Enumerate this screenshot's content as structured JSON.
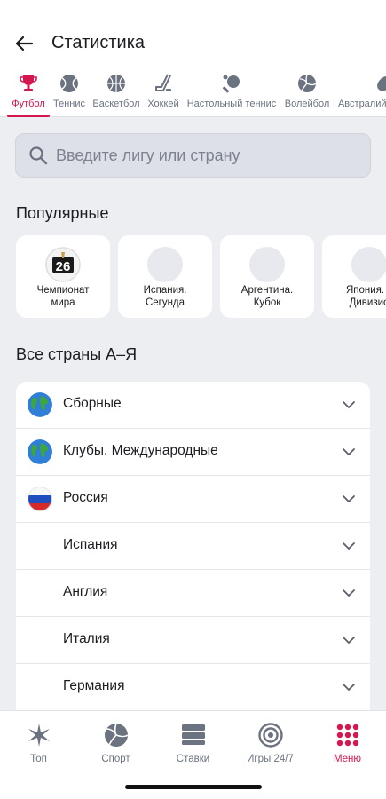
{
  "header": {
    "title": "Статистика",
    "back_icon": "arrow-left-icon"
  },
  "tabs": [
    {
      "label": "Футбол",
      "icon": "trophy-icon",
      "active": true
    },
    {
      "label": "Теннис",
      "icon": "tennis-ball-icon"
    },
    {
      "label": "Баскетбол",
      "icon": "basketball-icon"
    },
    {
      "label": "Хоккей",
      "icon": "hockey-stick-icon"
    },
    {
      "label": "Настольный теннис",
      "icon": "ping-pong-icon"
    },
    {
      "label": "Волейбол",
      "icon": "volleyball-icon"
    },
    {
      "label": "Австралийс",
      "icon": "aussie-rules-icon"
    }
  ],
  "search": {
    "placeholder": "Введите лигу или страну"
  },
  "popular": {
    "title": "Популярные",
    "items": [
      {
        "label": "Чемпионат\nмира",
        "logo": "world-cup-26-logo"
      },
      {
        "label": "Испания.\nСегунда",
        "logo": ""
      },
      {
        "label": "Аргентина.\nКубок",
        "logo": ""
      },
      {
        "label": "Япония. J\nДивизио",
        "logo": ""
      }
    ]
  },
  "countries": {
    "title": "Все страны А–Я",
    "items": [
      {
        "label": "Сборные",
        "flag": "globe"
      },
      {
        "label": "Клубы. Международные",
        "flag": "globe"
      },
      {
        "label": "Россия",
        "flag": "russia"
      },
      {
        "label": "Испания",
        "flag": ""
      },
      {
        "label": "Англия",
        "flag": ""
      },
      {
        "label": "Италия",
        "flag": ""
      },
      {
        "label": "Германия",
        "flag": ""
      }
    ]
  },
  "bottom_nav": [
    {
      "label": "Топ",
      "icon": "star-burst-icon"
    },
    {
      "label": "Спорт",
      "icon": "volleyball-icon"
    },
    {
      "label": "Ставки",
      "icon": "bet-slip-icon"
    },
    {
      "label": "Игры 24/7",
      "icon": "target-icon"
    },
    {
      "label": "Меню",
      "icon": "grid-menu-icon",
      "active": true
    }
  ],
  "colors": {
    "accent": "#d6164f",
    "background": "#eceef2",
    "card": "#ffffff"
  }
}
